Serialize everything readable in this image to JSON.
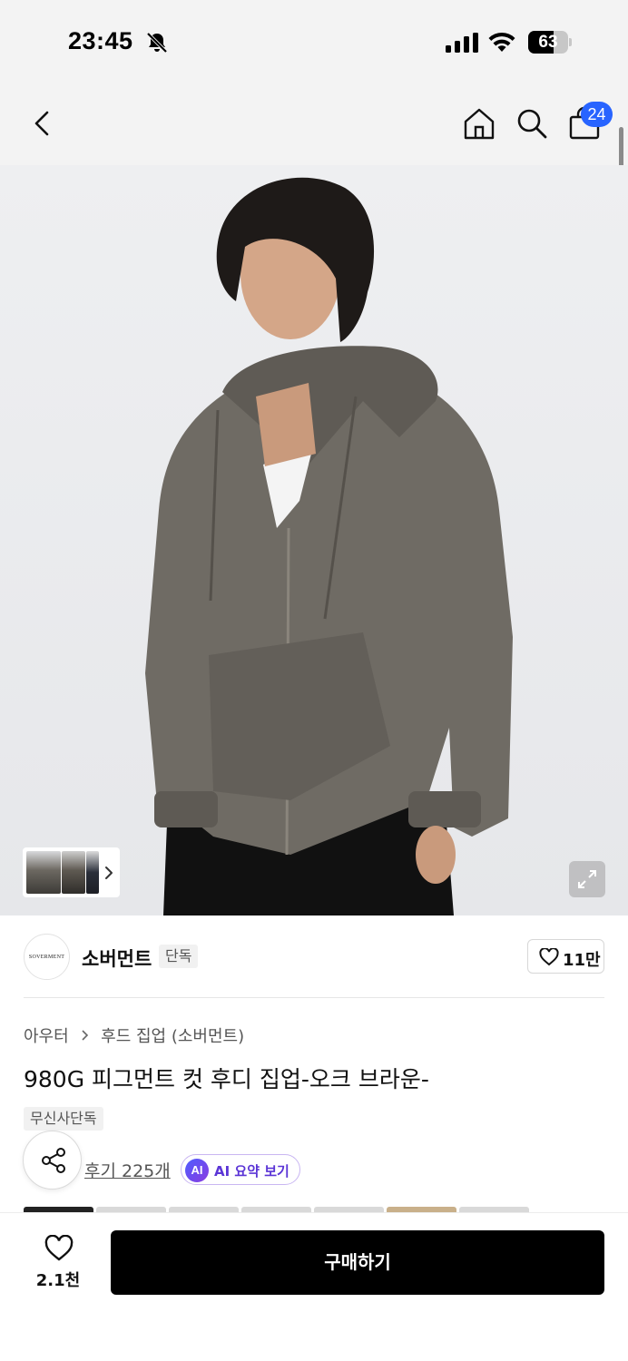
{
  "status_bar": {
    "time": "23:45",
    "battery_level": "63",
    "battery_fraction": 0.63
  },
  "nav": {
    "cart_count": "24",
    "icons": [
      "chevron-left-icon",
      "home-icon",
      "search-icon",
      "shopping-bag-icon"
    ]
  },
  "brand": {
    "logo_text": "SOVERMENT",
    "name": "소버먼트",
    "tag": "단독",
    "like_count": "11만"
  },
  "product": {
    "category": "아우터",
    "subcategory": "후드 집업 (소버먼트)",
    "title": "980G 피그먼트 컷 후디 집업-오크 브라운-",
    "exclusive_tag": "무신사단독",
    "review_label": "후기 225개",
    "ai_badge": "AI",
    "ai_summary_label": "AI 요약 보기"
  },
  "bottom_bar": {
    "like_count": "2.1천",
    "buy_label": "구매하기"
  },
  "colors": {
    "accent_blue": "#2864ff",
    "ai_purple": "#5b35d6",
    "buy_button": "#000000"
  }
}
